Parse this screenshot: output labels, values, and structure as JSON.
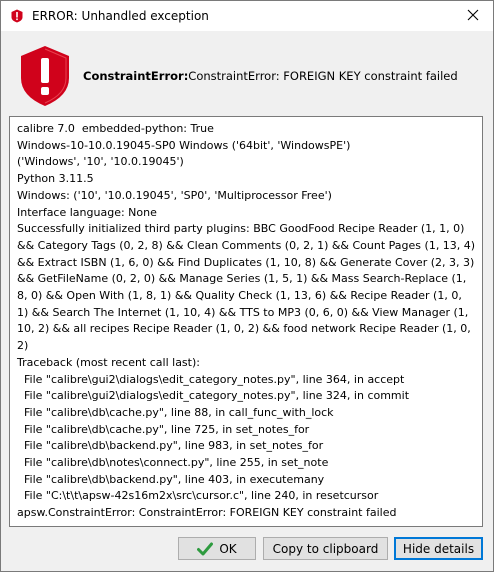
{
  "window": {
    "title": "ERROR: Unhandled exception"
  },
  "header": {
    "error_type": "ConstraintError:",
    "message": "ConstraintError: FOREIGN KEY constraint failed"
  },
  "details": {
    "lines": [
      "calibre 7.0  embedded-python: True",
      "Windows-10-10.0.19045-SP0 Windows ('64bit', 'WindowsPE')",
      "('Windows', '10', '10.0.19045')",
      "Python 3.11.5",
      "Windows: ('10', '10.0.19045', 'SP0', 'Multiprocessor Free')",
      "Interface language: None"
    ],
    "plugins_text": "Successfully initialized third party plugins: BBC GoodFood Recipe Reader (1, 1, 0) && Category Tags (0, 2, 8) && Clean Comments (0, 2, 1) && Count Pages (1, 13, 4) && Extract ISBN (1, 6, 0) && Find Duplicates (1, 10, 8) && Generate Cover (2, 3, 3) && GetFileName (0, 2, 0) && Manage Series (1, 5, 1) && Mass Search-Replace (1, 8, 0) && Open With (1, 8, 1) && Quality Check (1, 13, 6) && Recipe Reader (1, 0, 1) && Search The Internet (1, 10, 4) && TTS to MP3 (0, 6, 0) && View Manager (1, 10, 2) && all recipes Recipe Reader (1, 0, 2) && food network Recipe Reader (1, 0, 2)",
    "traceback": [
      "Traceback (most recent call last):",
      "  File \"calibre\\gui2\\dialogs\\edit_category_notes.py\", line 364, in accept",
      "  File \"calibre\\gui2\\dialogs\\edit_category_notes.py\", line 324, in commit",
      "  File \"calibre\\db\\cache.py\", line 88, in call_func_with_lock",
      "  File \"calibre\\db\\cache.py\", line 725, in set_notes_for",
      "  File \"calibre\\db\\backend.py\", line 983, in set_notes_for",
      "  File \"calibre\\db\\notes\\connect.py\", line 255, in set_note",
      "  File \"calibre\\db\\backend.py\", line 403, in executemany",
      "  File \"C:\\t\\t\\apsw-42s16m2x\\src\\cursor.c\", line 240, in resetcursor",
      "apsw.ConstraintError: ConstraintError: FOREIGN KEY constraint failed"
    ]
  },
  "buttons": {
    "ok": "OK",
    "copy": "Copy to clipboard",
    "hide": "Hide details"
  },
  "icons": {
    "title": "error-shield-icon",
    "big": "error-shield-icon",
    "ok": "checkmark-icon",
    "close": "close-icon"
  },
  "colors": {
    "error_red": "#d0021b",
    "ok_green": "#2e9b3f"
  }
}
